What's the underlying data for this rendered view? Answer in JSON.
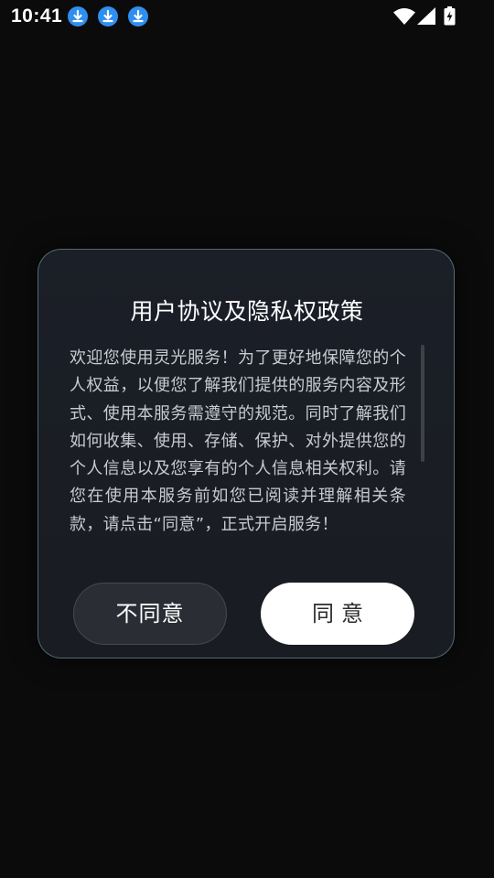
{
  "status_bar": {
    "time": "10:41",
    "notification_icons": [
      "download-icon",
      "download-icon",
      "download-icon"
    ],
    "right_icons": [
      "wifi-icon",
      "signal-icon",
      "battery-charging-icon"
    ],
    "accent_color": "#2f8ff0"
  },
  "dialog": {
    "title": "用户协议及隐私权政策",
    "body": "欢迎您使用灵光服务！为了更好地保障您的个人权益，以便您了解我们提供的服务内容及形式、使用本服务需遵守的规范。同时了解我们如何收集、使用、存储、保护、对外提供您的个人信息以及您享有的个人信息相关权利。请您在使用本服务前如您已阅读并理解相关条款，请点击“同意”，正式开启服务！",
    "disagree_label": "不同意",
    "agree_label": "同意"
  }
}
